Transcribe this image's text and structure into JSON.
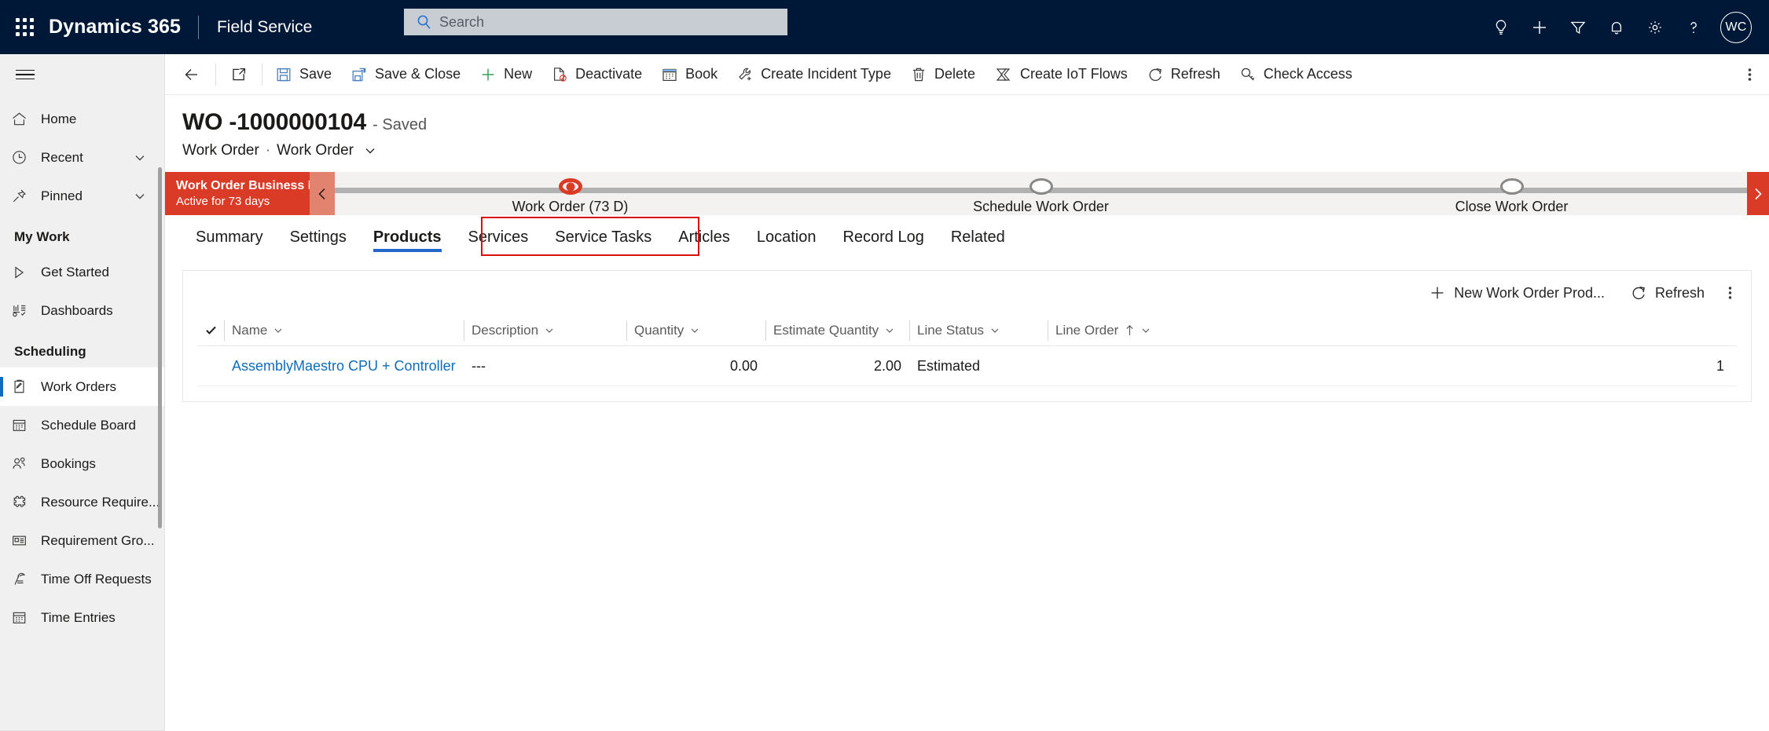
{
  "topnav": {
    "waffle_label": "app-launcher",
    "brand": "Dynamics 365",
    "app_name": "Field Service",
    "search_placeholder": "Search",
    "icons": [
      "lightbulb-icon",
      "plus-icon",
      "filter-icon",
      "bell-icon",
      "gear-icon",
      "help-icon"
    ],
    "avatar_initials": "WC",
    "bg_color": "#001838"
  },
  "sidebar": {
    "top_items": [
      {
        "label": "Home",
        "icon": "home-icon",
        "chevron": false
      },
      {
        "label": "Recent",
        "icon": "clock-icon",
        "chevron": true
      },
      {
        "label": "Pinned",
        "icon": "pin-icon",
        "chevron": true
      }
    ],
    "groups": [
      {
        "title": "My Work",
        "items": [
          {
            "label": "Get Started",
            "icon": "play-icon",
            "selected": false
          },
          {
            "label": "Dashboards",
            "icon": "dashboard-icon",
            "selected": false
          }
        ]
      },
      {
        "title": "Scheduling",
        "items": [
          {
            "label": "Work Orders",
            "icon": "clipboard-icon",
            "selected": true
          },
          {
            "label": "Schedule Board",
            "icon": "calendar-icon",
            "selected": false
          },
          {
            "label": "Bookings",
            "icon": "people-icon",
            "selected": false
          },
          {
            "label": "Resource Require...",
            "icon": "puzzle-icon",
            "selected": false
          },
          {
            "label": "Requirement Gro...",
            "icon": "card-icon",
            "selected": false
          },
          {
            "label": "Time Off Requests",
            "icon": "timeoff-icon",
            "selected": false
          },
          {
            "label": "Time Entries",
            "icon": "calendar-icon",
            "selected": false
          }
        ]
      }
    ]
  },
  "commandbar": {
    "back_label": "back-button",
    "popout_label": "open-in-new-window",
    "items": [
      {
        "label": "Save",
        "icon": "save-icon"
      },
      {
        "label": "Save & Close",
        "icon": "save-close-icon"
      },
      {
        "label": "New",
        "icon": "plus-icon"
      },
      {
        "label": "Deactivate",
        "icon": "deactivate-icon"
      },
      {
        "label": "Book",
        "icon": "calendar-icon"
      },
      {
        "label": "Create Incident Type",
        "icon": "wrench-plus-icon"
      },
      {
        "label": "Delete",
        "icon": "trash-icon"
      },
      {
        "label": "Create IoT Flows",
        "icon": "iot-flows-icon"
      },
      {
        "label": "Refresh",
        "icon": "refresh-icon"
      },
      {
        "label": "Check Access",
        "icon": "key-icon"
      }
    ],
    "overflow_label": "more-commands"
  },
  "record": {
    "title": "WO -1000000104",
    "saved_state": "- Saved",
    "entity": "Work Order",
    "separator": "·",
    "form_name": "Work Order"
  },
  "bpf": {
    "name": "Work Order Business Pro...",
    "status": "Active for 73 days",
    "accent_color": "#d93b26",
    "collapse_label": "collapse-process",
    "next_label": "next-stage",
    "stages": [
      {
        "label": "Work Order",
        "days": "(73 D)",
        "state": "active"
      },
      {
        "label": "Schedule Work Order",
        "days": "",
        "state": "idle"
      },
      {
        "label": "Close Work Order",
        "days": "",
        "state": "idle"
      }
    ]
  },
  "tabs": {
    "items": [
      {
        "label": "Summary",
        "active": false
      },
      {
        "label": "Settings",
        "active": false
      },
      {
        "label": "Products",
        "active": true
      },
      {
        "label": "Services",
        "active": false
      },
      {
        "label": "Service Tasks",
        "active": false
      },
      {
        "label": "Articles",
        "active": false
      },
      {
        "label": "Location",
        "active": false
      },
      {
        "label": "Record Log",
        "active": false
      },
      {
        "label": "Related",
        "active": false
      }
    ],
    "annotation_color": "#d91010"
  },
  "grid": {
    "toolbar": {
      "new_label": "New Work Order Prod...",
      "refresh_label": "Refresh",
      "overflow_label": "more-grid-commands"
    },
    "columns": [
      {
        "label": "Name"
      },
      {
        "label": "Description"
      },
      {
        "label": "Quantity"
      },
      {
        "label": "Estimate Quantity"
      },
      {
        "label": "Line Status"
      },
      {
        "label": "Line Order",
        "sorted": "ascending"
      }
    ],
    "rows": [
      {
        "name": "AssemblyMaestro CPU + Controller",
        "description": "---",
        "quantity": "0.00",
        "estimate_quantity": "2.00",
        "line_status": "Estimated",
        "line_order": "1"
      }
    ]
  }
}
